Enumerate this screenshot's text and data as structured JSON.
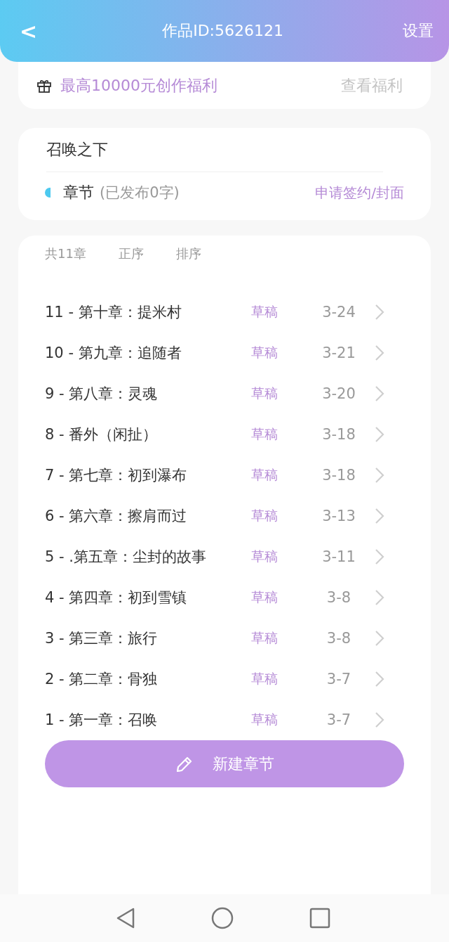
{
  "header": {
    "back": "<",
    "title": "作品ID:5626121",
    "settings": "设置"
  },
  "promo": {
    "text": "最高10000元创作福利",
    "link": "查看福利"
  },
  "work": {
    "title": "召唤之下",
    "section": "章节",
    "published": "(已发布0字)",
    "action": "申请签约/封面"
  },
  "toolbar": {
    "count": "共11章",
    "order": "正序",
    "sort": "排序"
  },
  "chapters": [
    {
      "title": "11 - 第十章：提米村",
      "status": "草稿",
      "date": "3-24"
    },
    {
      "title": "10 - 第九章：追随者",
      "status": "草稿",
      "date": "3-21"
    },
    {
      "title": "9 - 第八章：灵魂",
      "status": "草稿",
      "date": "3-20"
    },
    {
      "title": "8 - 番外（闲扯）",
      "status": "草稿",
      "date": "3-18"
    },
    {
      "title": "7 - 第七章：初到瀑布",
      "status": "草稿",
      "date": "3-18"
    },
    {
      "title": "6 - 第六章：擦肩而过",
      "status": "草稿",
      "date": "3-13"
    },
    {
      "title": "5 - .第五章：尘封的故事",
      "status": "草稿",
      "date": "3-11"
    },
    {
      "title": "4 - 第四章：初到雪镇",
      "status": "草稿",
      "date": "3-8"
    },
    {
      "title": "3 - 第三章：旅行",
      "status": "草稿",
      "date": "3-8"
    },
    {
      "title": "2 - 第二章：骨独",
      "status": "草稿",
      "date": "3-7"
    },
    {
      "title": "1 - 第一章：召唤",
      "status": "草稿",
      "date": "3-7"
    }
  ],
  "new_chapter_button": "新建章节"
}
